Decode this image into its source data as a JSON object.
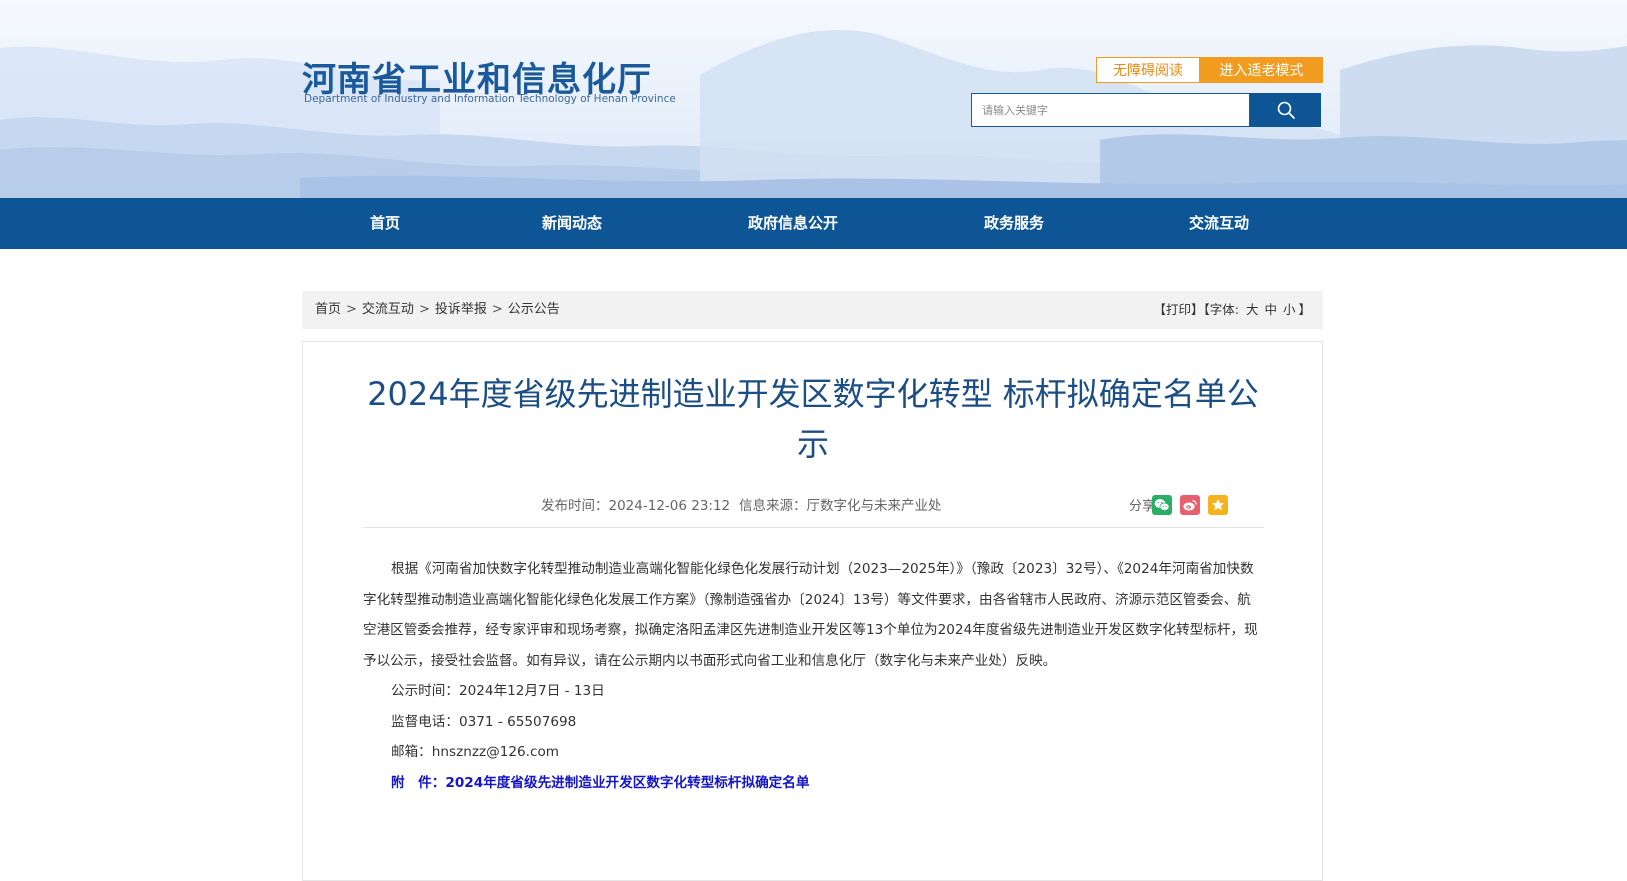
{
  "header": {
    "site_title": "河南省工业和信息化厅",
    "site_subtitle": "Department of Industry and Information Technology of Henan Province",
    "accessibility_label": "无障碍阅读",
    "elder_mode_label": "进入适老模式",
    "search": {
      "placeholder": "请输入关键字"
    }
  },
  "nav": {
    "items": [
      {
        "label": "首页"
      },
      {
        "label": "新闻动态"
      },
      {
        "label": "政府信息公开"
      },
      {
        "label": "政务服务"
      },
      {
        "label": "交流互动"
      }
    ]
  },
  "breadcrumb": {
    "items": [
      {
        "label": "首页"
      },
      {
        "label": "交流互动"
      },
      {
        "label": "投诉举报"
      },
      {
        "label": "公示公告"
      }
    ],
    "separator": ">"
  },
  "tools": {
    "print": "【打印】",
    "font_open": "【字体:",
    "large": "大",
    "medium": "中",
    "small": "小",
    "font_close": "】"
  },
  "article": {
    "title": "2024年度省级先进制造业开发区数字化转型 标杆拟确定名单公示",
    "publish_time": "发布时间：2024-12-06 23:12",
    "source": "信息来源：厅数字化与未来产业处",
    "share_label": "分享:",
    "body": "根据《河南省加快数字化转型推动制造业高端化智能化绿色化发展行动计划（2023—2025年）》（豫政〔2023〕32号）、《2024年河南省加快数字化转型推动制造业高端化智能化绿色化发展工作方案》（豫制造强省办〔2024〕13号）等文件要求，由各省辖市人民政府、济源示范区管委会、航空港区管委会推荐，经专家评审和现场考察，拟确定洛阳孟津区先进制造业开发区等13个单位为2024年度省级先进制造业开发区数字化转型标杆，现予以公示，接受社会监督。如有异议，请在公示期内以书面形式向省工业和信息化厅（数字化与未来产业处）反映。",
    "period": "公示时间：2024年12月7日 - 13日",
    "phone": "监督电话：0371 - 65507698",
    "email": "邮箱：hnsznzz@126.com",
    "attachment": "附　件：2024年度省级先进制造业开发区数字化转型标杆拟确定名单"
  },
  "icons": {
    "search": "search-icon",
    "wechat": "wechat-icon",
    "weibo": "weibo-icon",
    "favorite": "star-icon"
  },
  "colors": {
    "brand_blue": "#0e5596",
    "title_blue": "#1c4e86",
    "accent_orange": "#f29c1f",
    "attachment_link": "#1515c8",
    "wechat_green": "#2aae67",
    "weibo_red": "#e6616e",
    "favorite_yellow": "#f5b21c"
  }
}
